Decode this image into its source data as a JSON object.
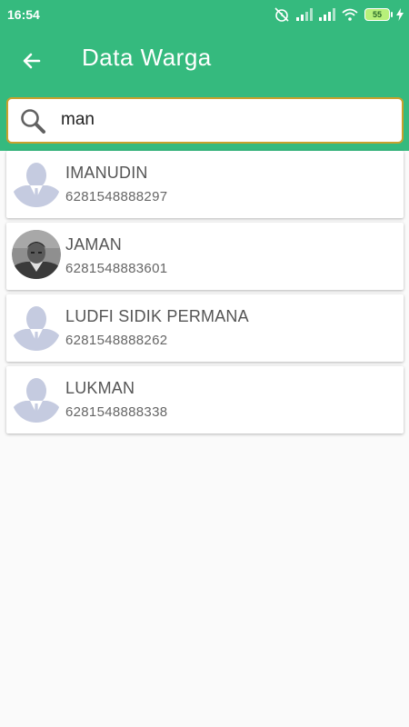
{
  "status_bar": {
    "time": "16:54",
    "battery_level": "55",
    "icons": [
      "alarm-off-icon",
      "signal-icon",
      "signal-icon",
      "wifi-icon",
      "battery-icon",
      "charging-icon"
    ]
  },
  "header": {
    "title": "Data Warga",
    "back_icon": "arrow-left-icon",
    "background_color": "#35ba7e"
  },
  "search": {
    "value": "man",
    "icon": "search-icon",
    "border_color": "#c9a12d"
  },
  "residents": [
    {
      "name": "IMANUDIN",
      "phone": "6281548888297",
      "avatar": "placeholder-silhouette"
    },
    {
      "name": "JAMAN",
      "phone": "6281548883601",
      "avatar": "photo"
    },
    {
      "name": "LUDFI SIDIK PERMANA",
      "phone": "6281548888262",
      "avatar": "placeholder-silhouette"
    },
    {
      "name": "LUKMAN",
      "phone": "6281548888338",
      "avatar": "placeholder-silhouette"
    }
  ]
}
